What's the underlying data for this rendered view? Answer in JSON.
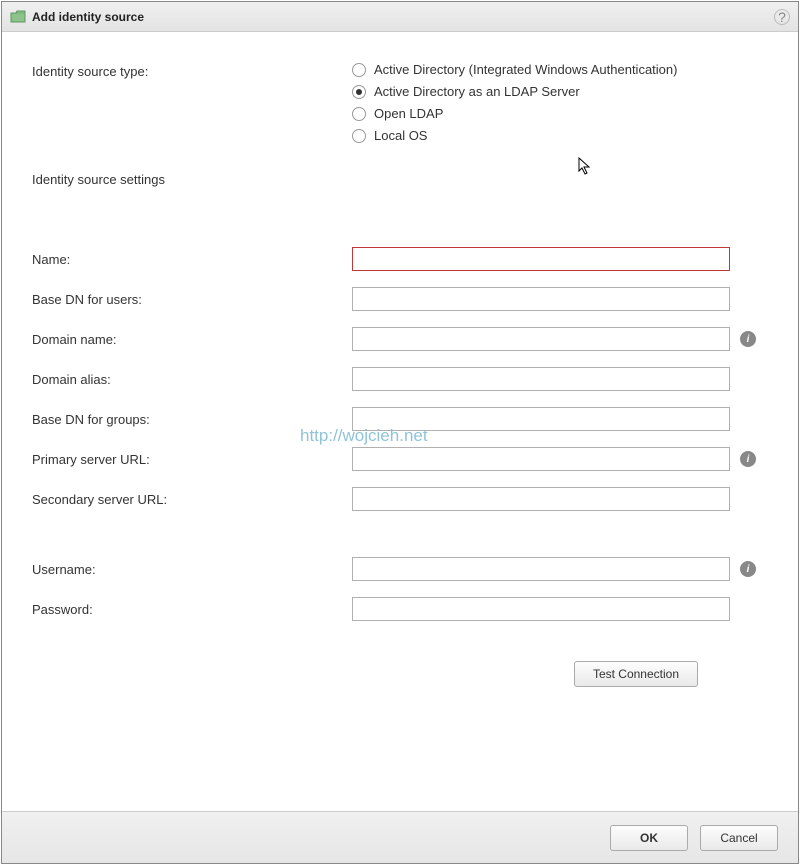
{
  "dialog": {
    "title": "Add identity source"
  },
  "labels": {
    "source_type": "Identity source type:",
    "settings": "Identity source settings"
  },
  "radios": {
    "ad_integrated": "Active Directory (Integrated Windows Authentication)",
    "ad_ldap": "Active Directory as an LDAP Server",
    "open_ldap": "Open LDAP",
    "local_os": "Local OS",
    "selected": "ad_ldap"
  },
  "fields": {
    "name": {
      "label": "Name:",
      "value": ""
    },
    "base_dn_users": {
      "label": "Base DN for users:",
      "value": ""
    },
    "domain_name": {
      "label": "Domain name:",
      "value": ""
    },
    "domain_alias": {
      "label": "Domain alias:",
      "value": ""
    },
    "base_dn_groups": {
      "label": "Base DN for groups:",
      "value": ""
    },
    "primary_url": {
      "label": "Primary server URL:",
      "value": ""
    },
    "secondary_url": {
      "label": "Secondary server URL:",
      "value": ""
    },
    "username": {
      "label": "Username:",
      "value": ""
    },
    "password": {
      "label": "Password:",
      "value": ""
    }
  },
  "buttons": {
    "test": "Test Connection",
    "ok": "OK",
    "cancel": "Cancel"
  },
  "watermark": "http://wojcieh.net"
}
